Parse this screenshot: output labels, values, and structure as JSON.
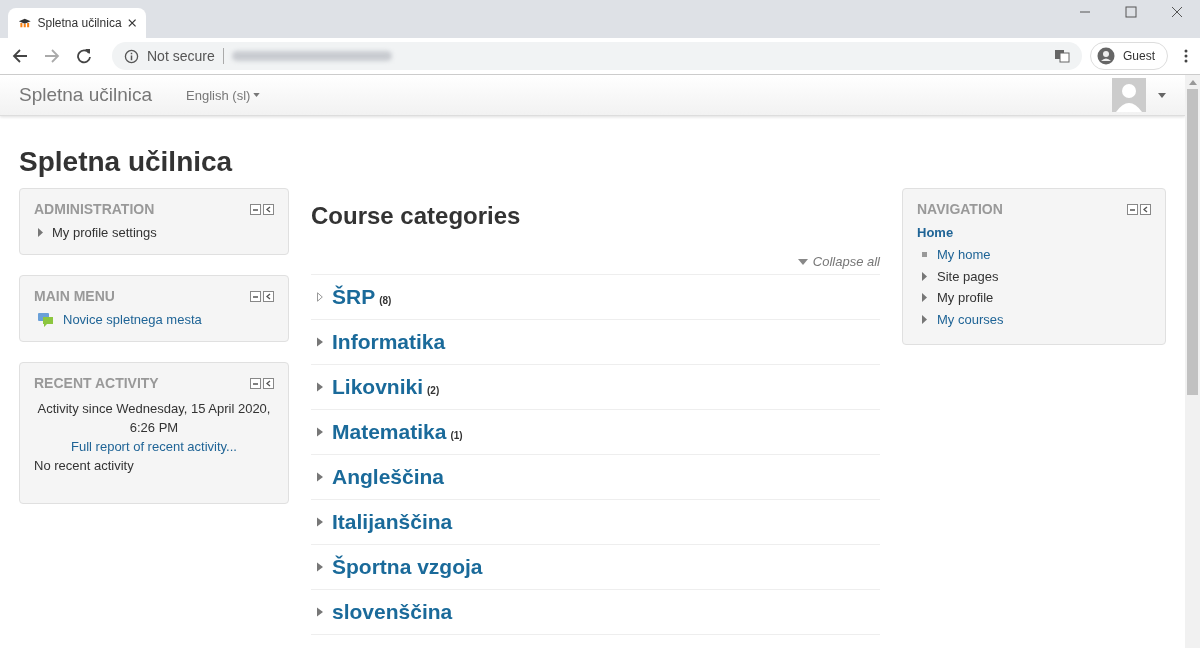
{
  "browser": {
    "tab_title": "Spletna učilnica",
    "security": "Not secure",
    "profile": "Guest"
  },
  "navbar": {
    "brand": "Spletna učilnica",
    "language": "English (sl)"
  },
  "page_title": "Spletna učilnica",
  "blocks_left": [
    {
      "kind": "tree",
      "title": "ADMINISTRATION",
      "items": [
        {
          "label": "My profile settings"
        }
      ]
    },
    {
      "kind": "menu",
      "title": "MAIN MENU",
      "items": [
        {
          "label": "Novice spletnega mesta"
        }
      ]
    },
    {
      "kind": "activity",
      "title": "RECENT ACTIVITY",
      "since": "Activity since Wednesday, 15 April 2020, 6:26 PM",
      "link": "Full report of recent activity...",
      "note": "No recent activity"
    }
  ],
  "main": {
    "heading": "Course categories",
    "collapse": "Collapse all",
    "categories": [
      {
        "name": "ŠRP",
        "count": "(8)",
        "kind": "outline"
      },
      {
        "name": "Informatika",
        "kind": "solid"
      },
      {
        "name": "Likovniki",
        "count": "(2)",
        "kind": "solid"
      },
      {
        "name": "Matematika",
        "count": "(1)",
        "kind": "solid"
      },
      {
        "name": "Angleščina",
        "kind": "solid"
      },
      {
        "name": "Italijanščina",
        "kind": "solid"
      },
      {
        "name": "Športna vzgoja",
        "kind": "solid"
      },
      {
        "name": "slovenščina",
        "kind": "solid"
      }
    ]
  },
  "navigation": {
    "title": "NAVIGATION",
    "home": "Home",
    "items": [
      {
        "label": "My home",
        "kind": "leaf",
        "link": true
      },
      {
        "label": "Site pages",
        "kind": "branch",
        "link": false
      },
      {
        "label": "My profile",
        "kind": "branch",
        "link": false
      },
      {
        "label": "My courses",
        "kind": "branch",
        "link": true
      }
    ]
  }
}
